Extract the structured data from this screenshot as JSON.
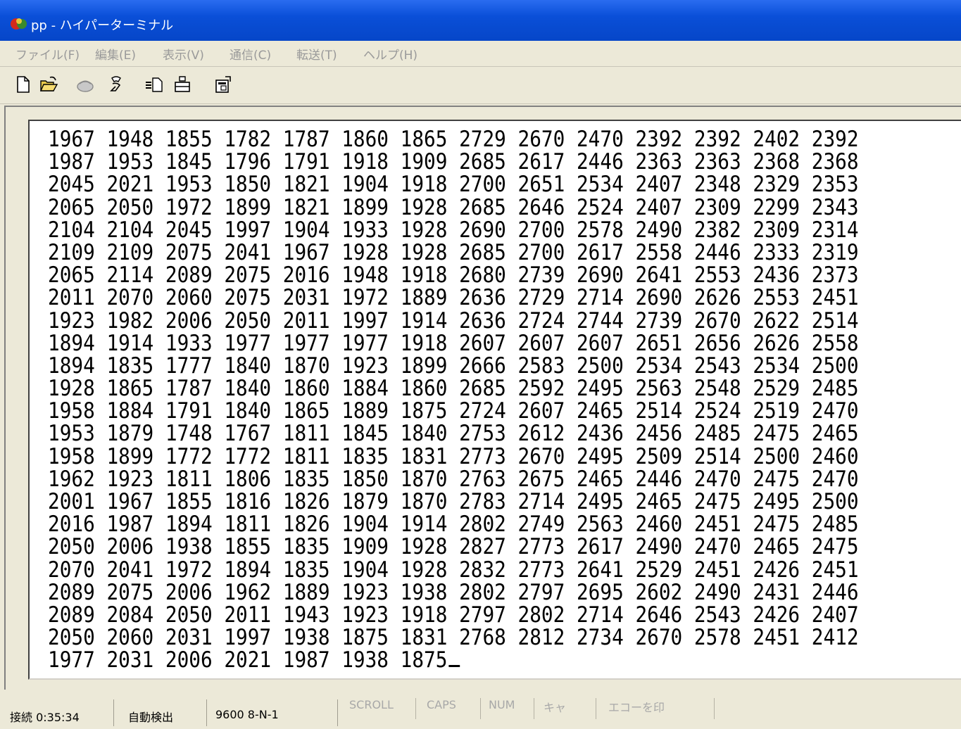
{
  "window": {
    "title": "pp - ハイパーターミナル"
  },
  "menu": {
    "items": [
      "ファイル(F)",
      "編集(E)",
      "表示(V)",
      "通信(C)",
      "転送(T)",
      "ヘルプ(H)"
    ]
  },
  "toolbar": {
    "buttons": [
      "new-icon",
      "open-icon",
      "disconnect-phone-icon",
      "connect-icon",
      "send-icon",
      "receive-icon",
      "properties-icon"
    ]
  },
  "terminal": {
    "lines": [
      "1967 1948 1855 1782 1787 1860 1865 2729 2670 2470 2392 2392 2402 2392",
      "1987 1953 1845 1796 1791 1918 1909 2685 2617 2446 2363 2363 2368 2368",
      "2045 2021 1953 1850 1821 1904 1918 2700 2651 2534 2407 2348 2329 2353",
      "2065 2050 1972 1899 1821 1899 1928 2685 2646 2524 2407 2309 2299 2343",
      "2104 2104 2045 1997 1904 1933 1928 2690 2700 2578 2490 2382 2309 2314",
      "2109 2109 2075 2041 1967 1928 1928 2685 2700 2617 2558 2446 2333 2319",
      "2065 2114 2089 2075 2016 1948 1918 2680 2739 2690 2641 2553 2436 2373",
      "2011 2070 2060 2075 2031 1972 1889 2636 2729 2714 2690 2626 2553 2451",
      "1923 1982 2006 2050 2011 1997 1914 2636 2724 2744 2739 2670 2622 2514",
      "1894 1914 1933 1977 1977 1977 1918 2607 2607 2607 2651 2656 2626 2558",
      "1894 1835 1777 1840 1870 1923 1899 2666 2583 2500 2534 2543 2534 2500",
      "1928 1865 1787 1840 1860 1884 1860 2685 2592 2495 2563 2548 2529 2485",
      "1958 1884 1791 1840 1865 1889 1875 2724 2607 2465 2514 2524 2519 2470",
      "1953 1879 1748 1767 1811 1845 1840 2753 2612 2436 2456 2485 2475 2465",
      "1958 1899 1772 1772 1811 1835 1831 2773 2670 2495 2509 2514 2500 2460",
      "1962 1923 1811 1806 1835 1850 1870 2763 2675 2465 2446 2470 2475 2470",
      "2001 1967 1855 1816 1826 1879 1870 2783 2714 2495 2465 2475 2495 2500",
      "2016 1987 1894 1811 1826 1904 1914 2802 2749 2563 2460 2451 2475 2485",
      "2050 2006 1938 1855 1835 1909 1928 2827 2773 2617 2490 2470 2465 2475",
      "2070 2041 1972 1894 1835 1904 1928 2832 2773 2641 2529 2451 2426 2451",
      "2089 2075 2006 1962 1889 1923 1938 2802 2797 2695 2602 2490 2431 2446",
      "2089 2084 2050 2011 1943 1923 1918 2797 2802 2714 2646 2543 2426 2407",
      "2050 2060 2031 1997 1938 1875 1831 2768 2812 2734 2670 2578 2451 2412",
      "1977 2031 2006 2021 1987 1938 1875"
    ]
  },
  "status": {
    "connection": "接続 0:35:34",
    "detect": "自動検出",
    "settings": "9600 8-N-1",
    "indicators": [
      "SCROLL",
      "CAPS",
      "NUM",
      "キャ",
      "エコーを印"
    ]
  }
}
